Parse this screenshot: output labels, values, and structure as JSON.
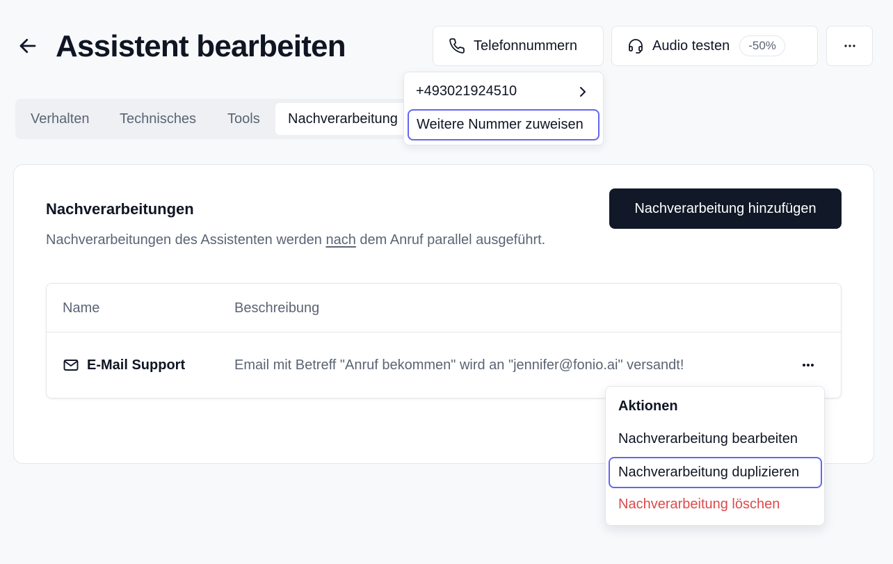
{
  "header": {
    "title": "Assistent bearbeiten",
    "phone_button": "Telefonnummern",
    "audio_button": "Audio testen",
    "audio_badge": "-50%"
  },
  "tabs": [
    {
      "label": "Verhalten"
    },
    {
      "label": "Technisches"
    },
    {
      "label": "Tools"
    },
    {
      "label": "Nachverarbeitung"
    }
  ],
  "phone_menu": {
    "number": "+493021924510",
    "assign_label": "Weitere Nummer zuweisen"
  },
  "section": {
    "title": "Nachverarbeitungen",
    "desc_before": "Nachverarbeitungen des Assistenten werden ",
    "desc_emphasis": "nach",
    "desc_after": " dem Anruf parallel ausgeführt.",
    "add_button": "Nachverarbeitung hinzufügen"
  },
  "table": {
    "columns": [
      "Name",
      "Beschreibung"
    ],
    "rows": [
      {
        "icon": "mail-icon",
        "name": "E-Mail Support",
        "description": "Email mit Betreff \"Anruf bekommen\" wird an \"jennifer@fonio.ai\" versandt!"
      }
    ]
  },
  "actions_menu": {
    "heading": "Aktionen",
    "items": [
      {
        "label": "Nachverarbeitung bearbeiten"
      },
      {
        "label": "Nachverarbeitung duplizieren"
      },
      {
        "label": "Nachverarbeitung löschen"
      }
    ]
  },
  "colors": {
    "primary": "#111827",
    "focus_ring": "#6366f1",
    "danger": "#dc4a4a"
  }
}
